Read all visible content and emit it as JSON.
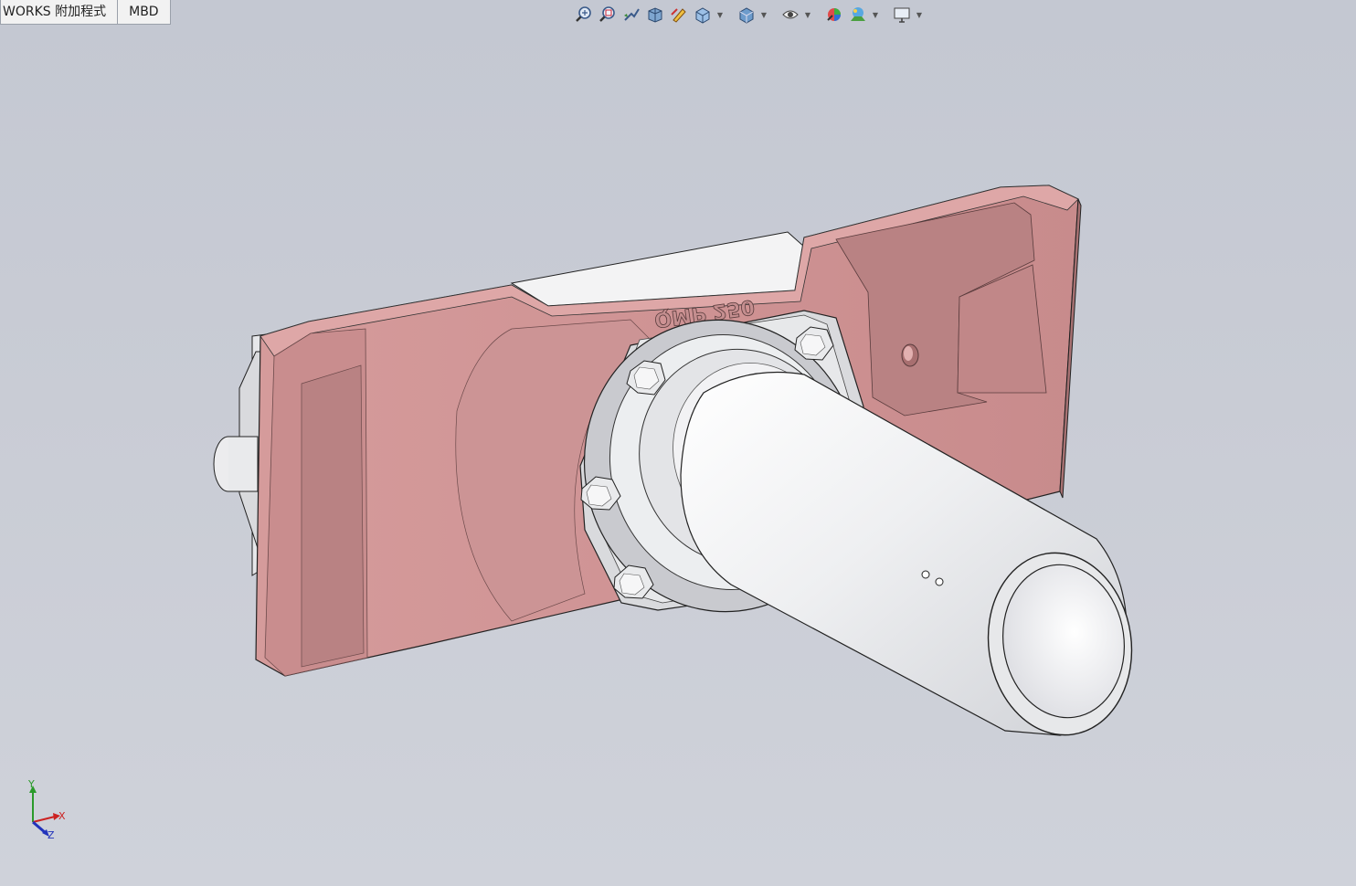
{
  "tabs": [
    {
      "label": "WORKS 附加程式"
    },
    {
      "label": "MBD"
    }
  ],
  "view_toolbar": {
    "icons": [
      "zoom-to-fit-icon",
      "zoom-to-area-icon",
      "previous-view-icon",
      "section-view-icon",
      "dynamic-annotation-icon",
      "view-orientation-icon",
      "display-style-icon",
      "hide-show-items-icon",
      "edit-appearance-icon",
      "apply-scene-icon",
      "view-settings-icon"
    ]
  },
  "model": {
    "engraved_text": "QMP 250",
    "colors": {
      "plate": "#d49a9a",
      "plate_dark": "#b97f80",
      "pipe": "#ececee",
      "background": "#c8cbd4"
    }
  },
  "triad": {
    "y_label": "Y",
    "x_label": "X",
    "z_label": "Z",
    "colors": {
      "y": "#2a9a2a",
      "x": "#cc2222",
      "z": "#2233bb"
    }
  }
}
